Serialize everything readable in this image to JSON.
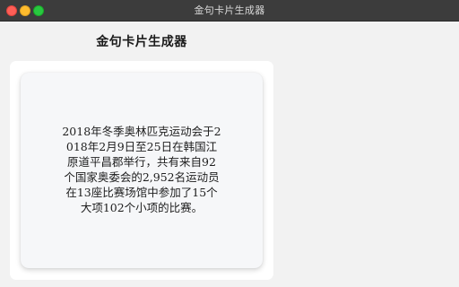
{
  "window": {
    "title": "金句卡片生成器"
  },
  "app": {
    "heading": "金句卡片生成器"
  },
  "card": {
    "quote": "2018年冬季奥林匹克运动会于2018年2月9日至25日在韩国江原道平昌郡举行，共有来自92个国家奥委会的2,952名运动员在13座比赛场馆中参加了15个大项102个小项的比赛。"
  },
  "colors": {
    "titlebar": "#3c3c3c",
    "close": "#fe5f57",
    "minimize": "#febc2e",
    "maximize": "#28c840",
    "card_background": "#f6f7f9"
  }
}
